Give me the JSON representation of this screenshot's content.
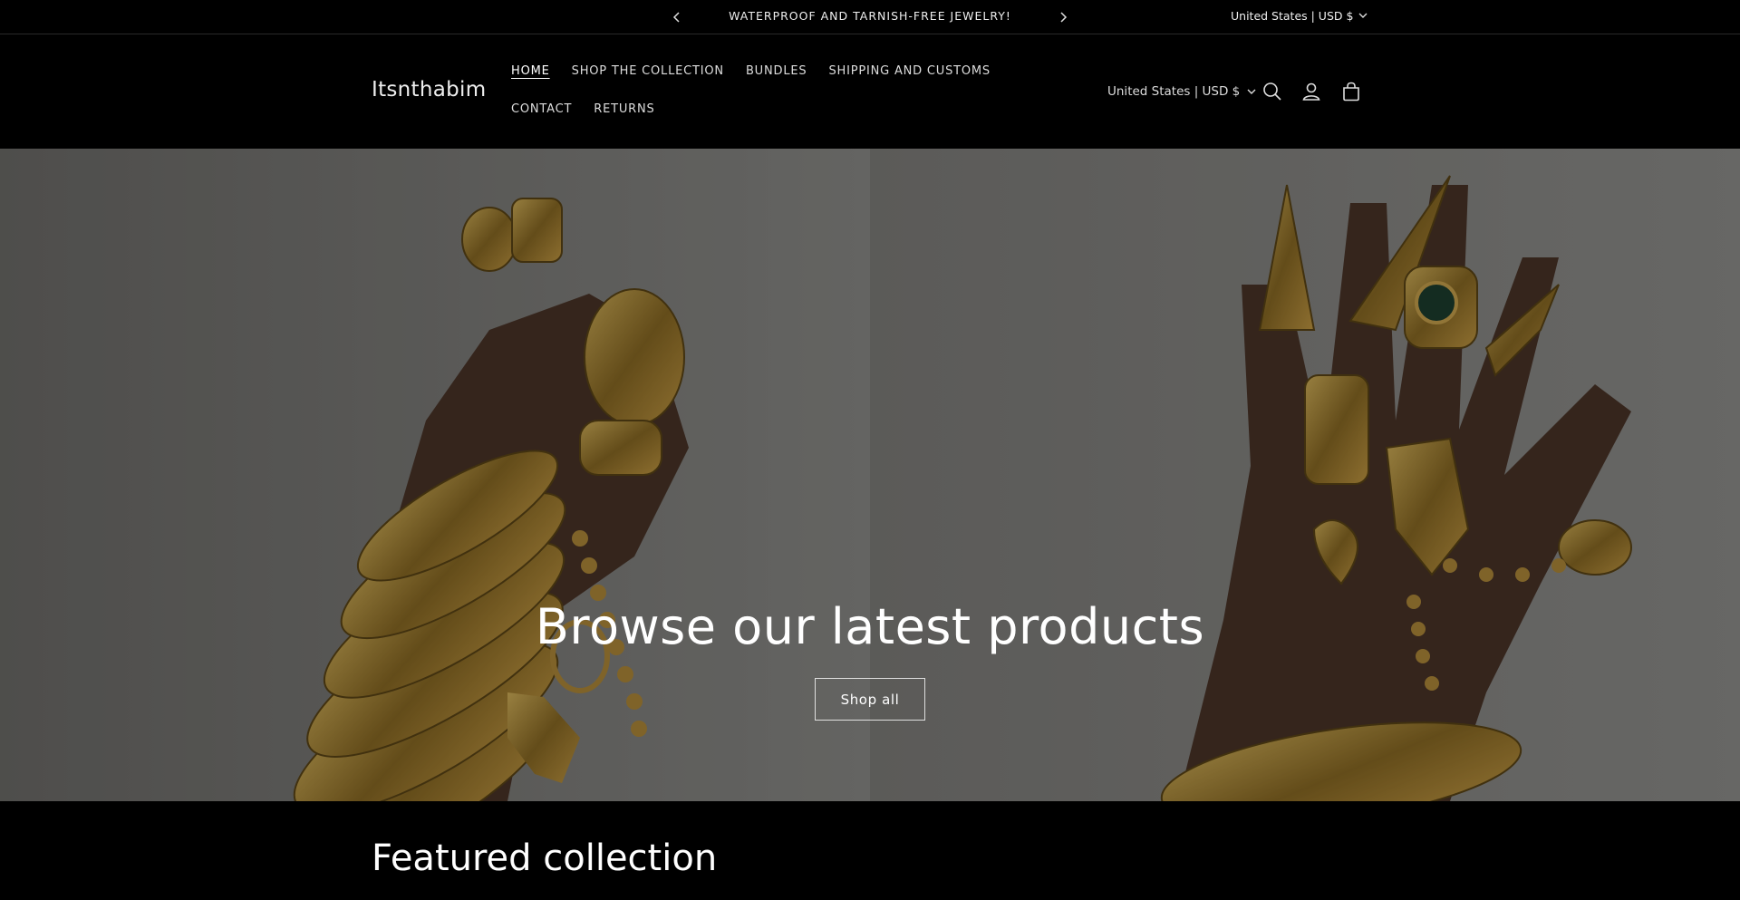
{
  "announcement": {
    "message": "WATERPROOF AND TARNISH-FREE JEWELRY!",
    "locale": "United States | USD $"
  },
  "header": {
    "logo": "Itsnthabim",
    "nav": [
      {
        "label": "HOME",
        "active": true
      },
      {
        "label": "SHOP THE COLLECTION"
      },
      {
        "label": "BUNDLES"
      },
      {
        "label": "SHIPPING AND CUSTOMS"
      },
      {
        "label": "CONTACT"
      },
      {
        "label": "RETURNS"
      }
    ],
    "locale": "United States | USD $",
    "icons": [
      "search-icon",
      "account-icon",
      "cart-icon"
    ]
  },
  "hero": {
    "title": "Browse our latest products",
    "button_label": "Shop all",
    "image_description_icons": [
      "hand-with-bangles",
      "hand-with-rings"
    ]
  },
  "featured": {
    "title": "Featured collection"
  },
  "colors": {
    "background": "#000000",
    "text": "#ffffff",
    "gold": "#b8923a"
  }
}
